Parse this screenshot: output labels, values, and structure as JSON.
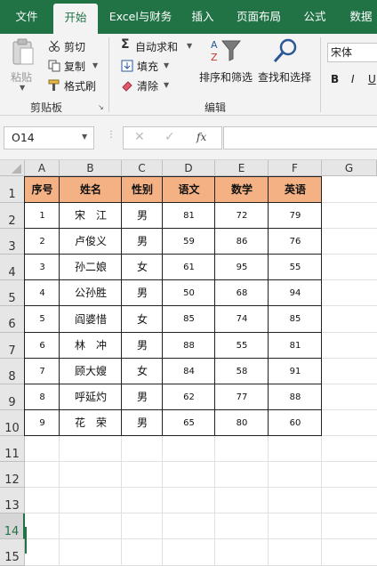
{
  "menu": {
    "tabs": [
      "文件",
      "开始",
      "Excel与财务",
      "插入",
      "页面布局",
      "公式",
      "数据"
    ],
    "active": "开始"
  },
  "ribbon": {
    "clipboard": {
      "paste": "粘贴",
      "cut": "剪切",
      "copy": "复制",
      "format_painter": "格式刷",
      "label": "剪贴板"
    },
    "editing": {
      "autosum": "自动求和",
      "fill": "填充",
      "clear": "清除",
      "sort_filter": "排序和筛选",
      "find_select": "查找和选择",
      "label": "编辑"
    },
    "font": {
      "name": "宋体",
      "bold": "B",
      "italic": "I",
      "underline": "U"
    }
  },
  "formula_bar": {
    "name_box": "O14",
    "fx": "fx",
    "value": ""
  },
  "sheet": {
    "columns": [
      "A",
      "B",
      "C",
      "D",
      "E",
      "F",
      "G"
    ],
    "rows": [
      "1",
      "2",
      "3",
      "4",
      "5",
      "6",
      "7",
      "8",
      "9",
      "10",
      "11",
      "12",
      "13",
      "14",
      "15"
    ],
    "selected_row": "14",
    "headers": [
      "序号",
      "姓名",
      "性别",
      "语文",
      "数学",
      "英语"
    ],
    "data": [
      [
        "1",
        "宋　江",
        "男",
        "81",
        "72",
        "79"
      ],
      [
        "2",
        "卢俊义",
        "男",
        "59",
        "86",
        "76"
      ],
      [
        "3",
        "孙二娘",
        "女",
        "61",
        "95",
        "55"
      ],
      [
        "4",
        "公孙胜",
        "男",
        "50",
        "68",
        "94"
      ],
      [
        "5",
        "阎婆惜",
        "女",
        "85",
        "74",
        "85"
      ],
      [
        "6",
        "林　冲",
        "男",
        "88",
        "55",
        "81"
      ],
      [
        "7",
        "顾大嫂",
        "女",
        "84",
        "58",
        "91"
      ],
      [
        "8",
        "呼延灼",
        "男",
        "62",
        "77",
        "88"
      ],
      [
        "9",
        "花　荣",
        "男",
        "65",
        "80",
        "60"
      ]
    ]
  },
  "colors": {
    "brand_green": "#217346",
    "header_fill": "#f4b183"
  }
}
